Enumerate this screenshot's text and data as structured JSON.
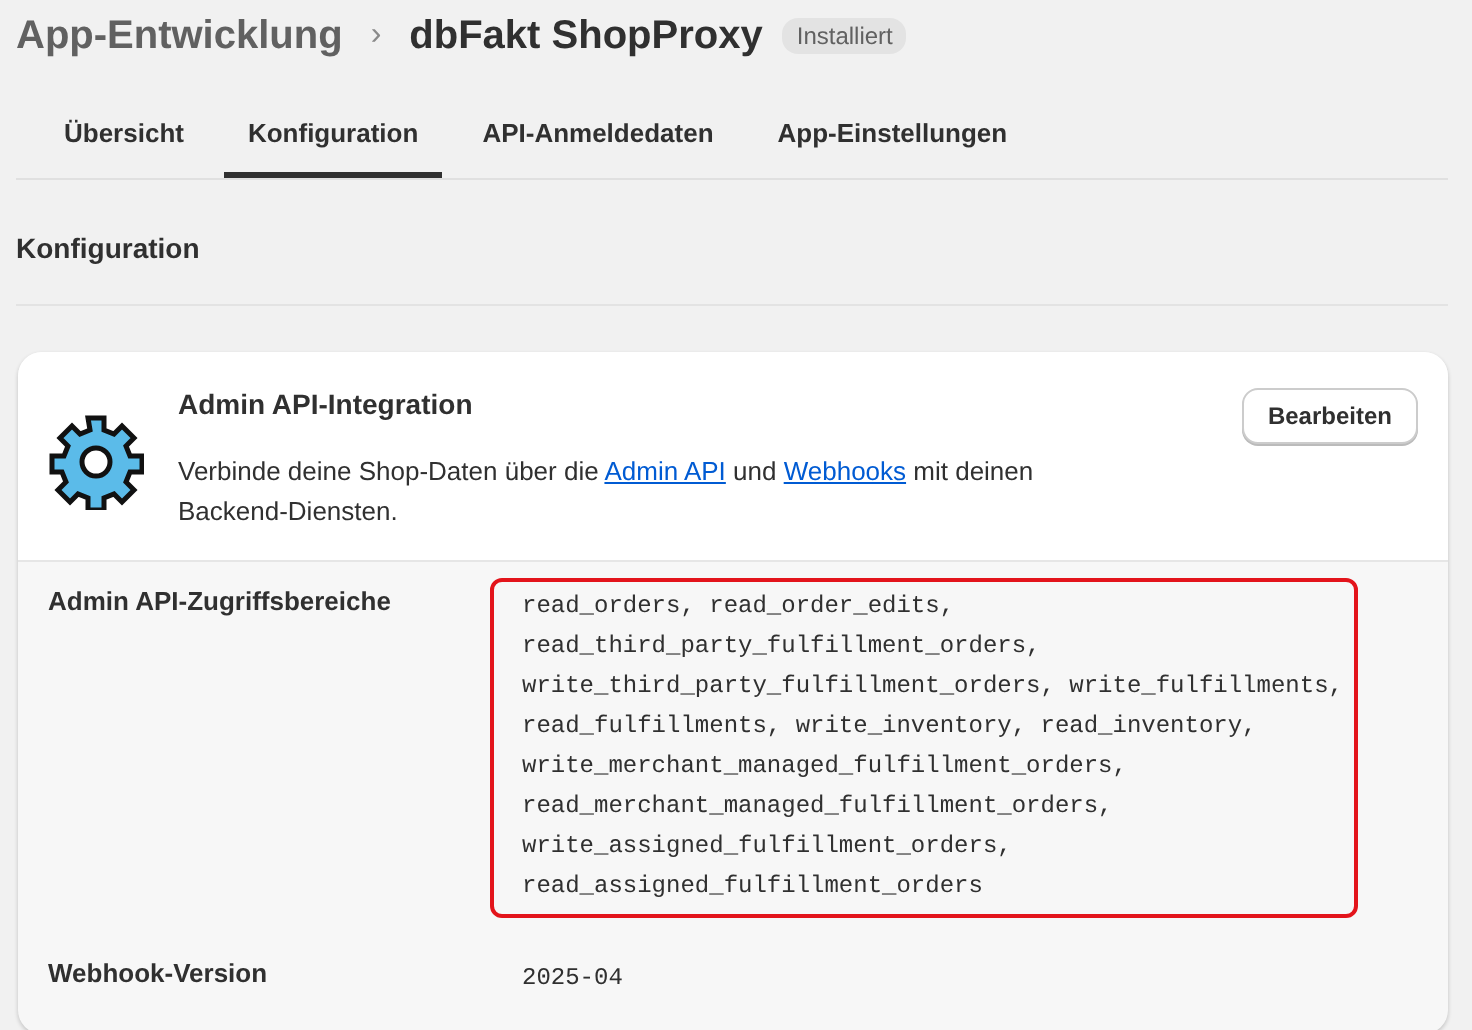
{
  "breadcrumb": {
    "parent": "App-Entwicklung",
    "separator": "›",
    "title": "dbFakt ShopProxy",
    "badge": "Installiert"
  },
  "tabs": [
    {
      "label": "Übersicht",
      "selected": false
    },
    {
      "label": "Konfiguration",
      "selected": true
    },
    {
      "label": "API-Anmeldedaten",
      "selected": false
    },
    {
      "label": "App-Einstellungen",
      "selected": false
    }
  ],
  "section_title": "Konfiguration",
  "card": {
    "title": "Admin API-Integration",
    "button": "Bearbeiten",
    "description": [
      {
        "text": "Verbinde deine Shop-Daten über die "
      },
      {
        "text": "Admin API",
        "link": true
      },
      {
        "text": " und "
      },
      {
        "text": "Webhooks",
        "link": true
      },
      {
        "text": " mit deinen Backend-Diensten."
      }
    ],
    "rows": [
      {
        "label": "Admin API-Zugriffsbereiche",
        "highlighted": true,
        "lines": [
          "read_orders, read_order_edits,",
          "read_third_party_fulfillment_orders,",
          "write_third_party_fulfillment_orders, write_fulfillments,",
          "read_fulfillments, write_inventory, read_inventory,",
          "write_merchant_managed_fulfillment_orders,",
          "read_merchant_managed_fulfillment_orders,",
          "write_assigned_fulfillment_orders,",
          "read_assigned_fulfillment_orders"
        ]
      },
      {
        "label": "Webhook-Version",
        "highlighted": false,
        "lines": [
          "2025-04"
        ]
      }
    ]
  }
}
